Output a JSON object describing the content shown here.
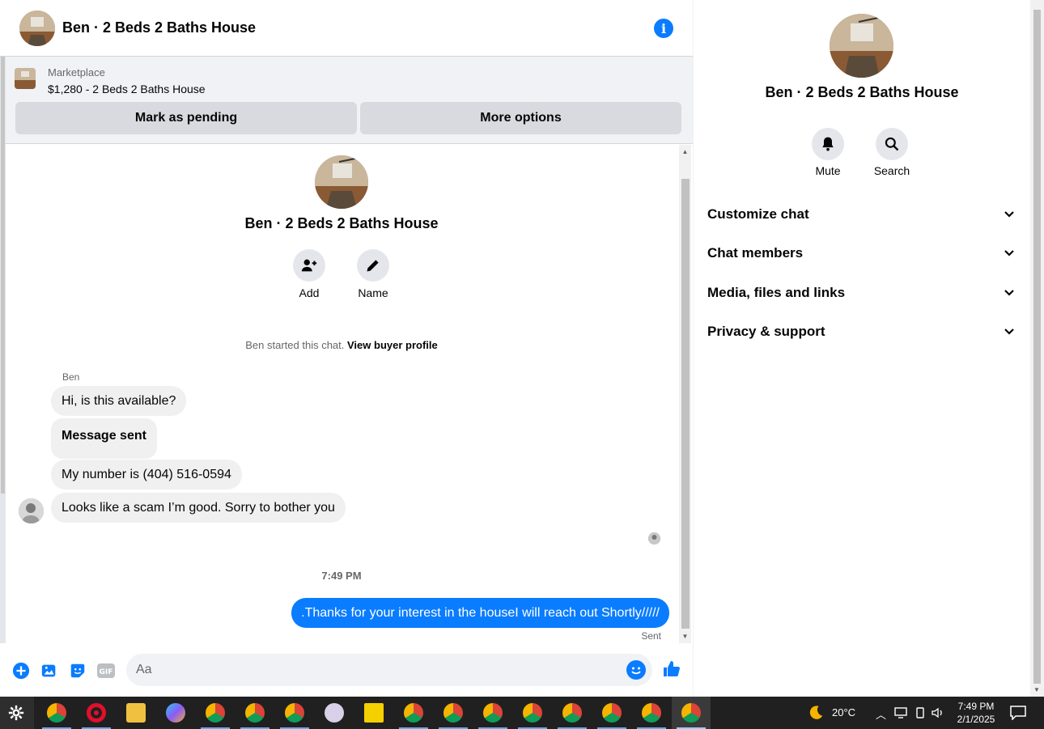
{
  "header": {
    "title": "Ben · 2 Beds 2 Baths House",
    "info_icon": "info-icon"
  },
  "listing": {
    "category": "Marketplace",
    "price_title": "$1,280 - 2 Beds 2 Baths House",
    "mark_pending_label": "Mark as pending",
    "more_options_label": "More options"
  },
  "intro": {
    "title": "Ben · 2 Beds 2 Baths House",
    "add_label": "Add",
    "name_label": "Name",
    "started_text": "Ben started this chat.",
    "view_profile_label": "View buyer profile"
  },
  "messages": {
    "sender": "Ben",
    "incoming": [
      "Hi, is this available?",
      "Message sent",
      "My number is (404) 516-0594",
      "Looks like a scam I’m good. Sorry to bother you"
    ],
    "timestamp": "7:49 PM",
    "outgoing": ".Thanks for your interest in the houseI will reach out Shortly/////",
    "status": "Sent"
  },
  "composer": {
    "placeholder": "Aa"
  },
  "side": {
    "title": "Ben · 2 Beds 2 Baths House",
    "mute_label": "Mute",
    "search_label": "Search",
    "sections": [
      "Customize chat",
      "Chat members",
      "Media, files and links",
      "Privacy & support"
    ]
  },
  "taskbar": {
    "temperature": "20°C",
    "time": "7:49 PM",
    "date": "2/1/2025"
  },
  "colors": {
    "accent": "#0a7cff",
    "bubble_in": "#f0f0f0",
    "taskbar": "#202020"
  }
}
